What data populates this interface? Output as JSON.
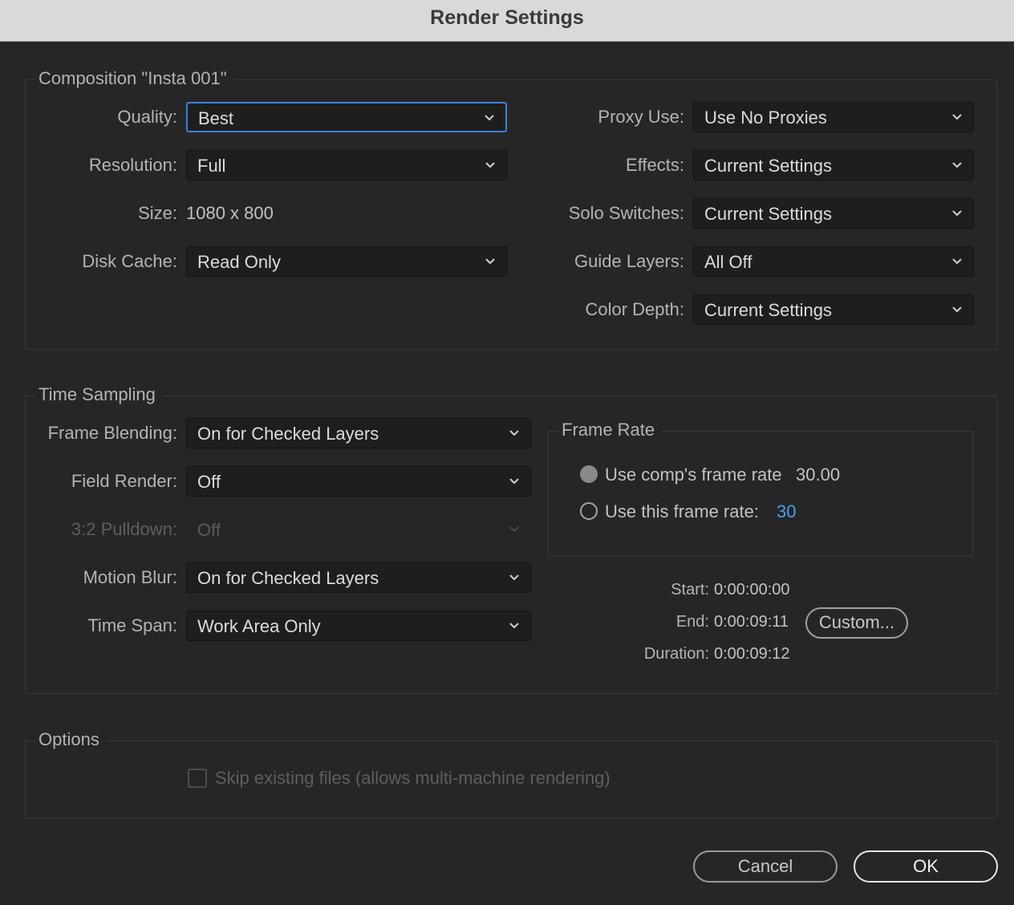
{
  "window": {
    "title": "Render Settings"
  },
  "composition": {
    "group_title": "Composition \"Insta 001\"",
    "quality": {
      "label": "Quality:",
      "value": "Best"
    },
    "resolution": {
      "label": "Resolution:",
      "value": "Full"
    },
    "size": {
      "label": "Size:",
      "value": "1080 x 800"
    },
    "disk_cache": {
      "label": "Disk Cache:",
      "value": "Read Only"
    },
    "proxy_use": {
      "label": "Proxy Use:",
      "value": "Use No Proxies"
    },
    "effects": {
      "label": "Effects:",
      "value": "Current Settings"
    },
    "solo_switches": {
      "label": "Solo Switches:",
      "value": "Current Settings"
    },
    "guide_layers": {
      "label": "Guide Layers:",
      "value": "All Off"
    },
    "color_depth": {
      "label": "Color Depth:",
      "value": "Current Settings"
    }
  },
  "time_sampling": {
    "group_title": "Time Sampling",
    "frame_blending": {
      "label": "Frame Blending:",
      "value": "On for Checked Layers"
    },
    "field_render": {
      "label": "Field Render:",
      "value": "Off"
    },
    "pulldown": {
      "label": "3:2 Pulldown:",
      "value": "Off"
    },
    "motion_blur": {
      "label": "Motion Blur:",
      "value": "On for Checked Layers"
    },
    "time_span": {
      "label": "Time Span:",
      "value": "Work Area Only"
    },
    "frame_rate": {
      "group_title": "Frame Rate",
      "use_comp_label": "Use comp's frame rate",
      "comp_rate": "30.00",
      "use_this_label": "Use this frame rate:",
      "this_rate": "30"
    },
    "start": {
      "label": "Start:",
      "value": "0:00:00:00"
    },
    "end": {
      "label": "End:",
      "value": "0:00:09:11"
    },
    "duration": {
      "label": "Duration:",
      "value": "0:00:09:12"
    },
    "custom_button": "Custom..."
  },
  "options": {
    "group_title": "Options",
    "skip_existing": "Skip existing files (allows multi-machine rendering)"
  },
  "buttons": {
    "cancel": "Cancel",
    "ok": "OK"
  },
  "colors": {
    "accent": "#3b82d8",
    "link_value": "#4a9ff0"
  }
}
